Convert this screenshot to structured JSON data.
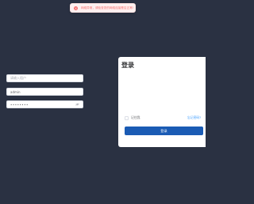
{
  "toast": {
    "icon": "error-icon",
    "message": "网络异常，请检查您的网络连接是否正常!"
  },
  "login": {
    "title": "登录",
    "tenant_placeholder": "请输入租户",
    "username": "admin",
    "password_masked": "••••••••",
    "remember_label": "记住我",
    "forgot_label": "忘记密码?",
    "submit_label": "登录"
  },
  "colors": {
    "background": "#2a3142",
    "primary_button": "#1a5bb4",
    "error": "#f56c6c",
    "link": "#409eff"
  }
}
